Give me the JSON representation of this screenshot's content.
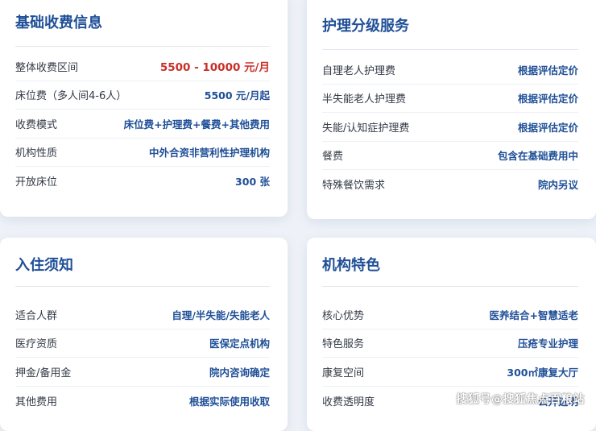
{
  "cards": [
    {
      "title": "基础收费信息",
      "rows": [
        {
          "label": "整体收费区间",
          "value": "5500 - 10000 元/月"
        },
        {
          "label": "床位费（多人间4-6人）",
          "value": "5500 元/月起"
        },
        {
          "label": "收费模式",
          "value": "床位费+护理费+餐费+其他费用"
        },
        {
          "label": "机构性质",
          "value": "中外合资非营利性护理机构"
        },
        {
          "label": "开放床位",
          "value": "300 张"
        }
      ]
    },
    {
      "title": "护理分级服务",
      "rows": [
        {
          "label": "自理老人护理费",
          "value": "根据评估定价"
        },
        {
          "label": "半失能老人护理费",
          "value": "根据评估定价"
        },
        {
          "label": "失能/认知症护理费",
          "value": "根据评估定价"
        },
        {
          "label": "餐费",
          "value": "包含在基础费用中"
        },
        {
          "label": "特殊餐饮需求",
          "value": "院内另议"
        }
      ]
    },
    {
      "title": "入住须知",
      "rows": [
        {
          "label": "适合人群",
          "value": "自理/半失能/失能老人"
        },
        {
          "label": "医疗资质",
          "value": "医保定点机构"
        },
        {
          "label": "押金/备用金",
          "value": "院内咨询确定"
        },
        {
          "label": "其他费用",
          "value": "根据实际使用收取"
        }
      ]
    },
    {
      "title": "机构特色",
      "rows": [
        {
          "label": "核心优势",
          "value": "医养结合+智慧适老"
        },
        {
          "label": "特色服务",
          "value": "压疮专业护理"
        },
        {
          "label": "康复空间",
          "value": "300㎡康复大厅"
        },
        {
          "label": "收费透明度",
          "value": "公开透明"
        }
      ]
    }
  ],
  "watermark": "搜狐号@搜狐焦点百粮站",
  "colors": {
    "accent": "#1f4f97",
    "price": "#c8312a",
    "background": "#eef2f8"
  }
}
